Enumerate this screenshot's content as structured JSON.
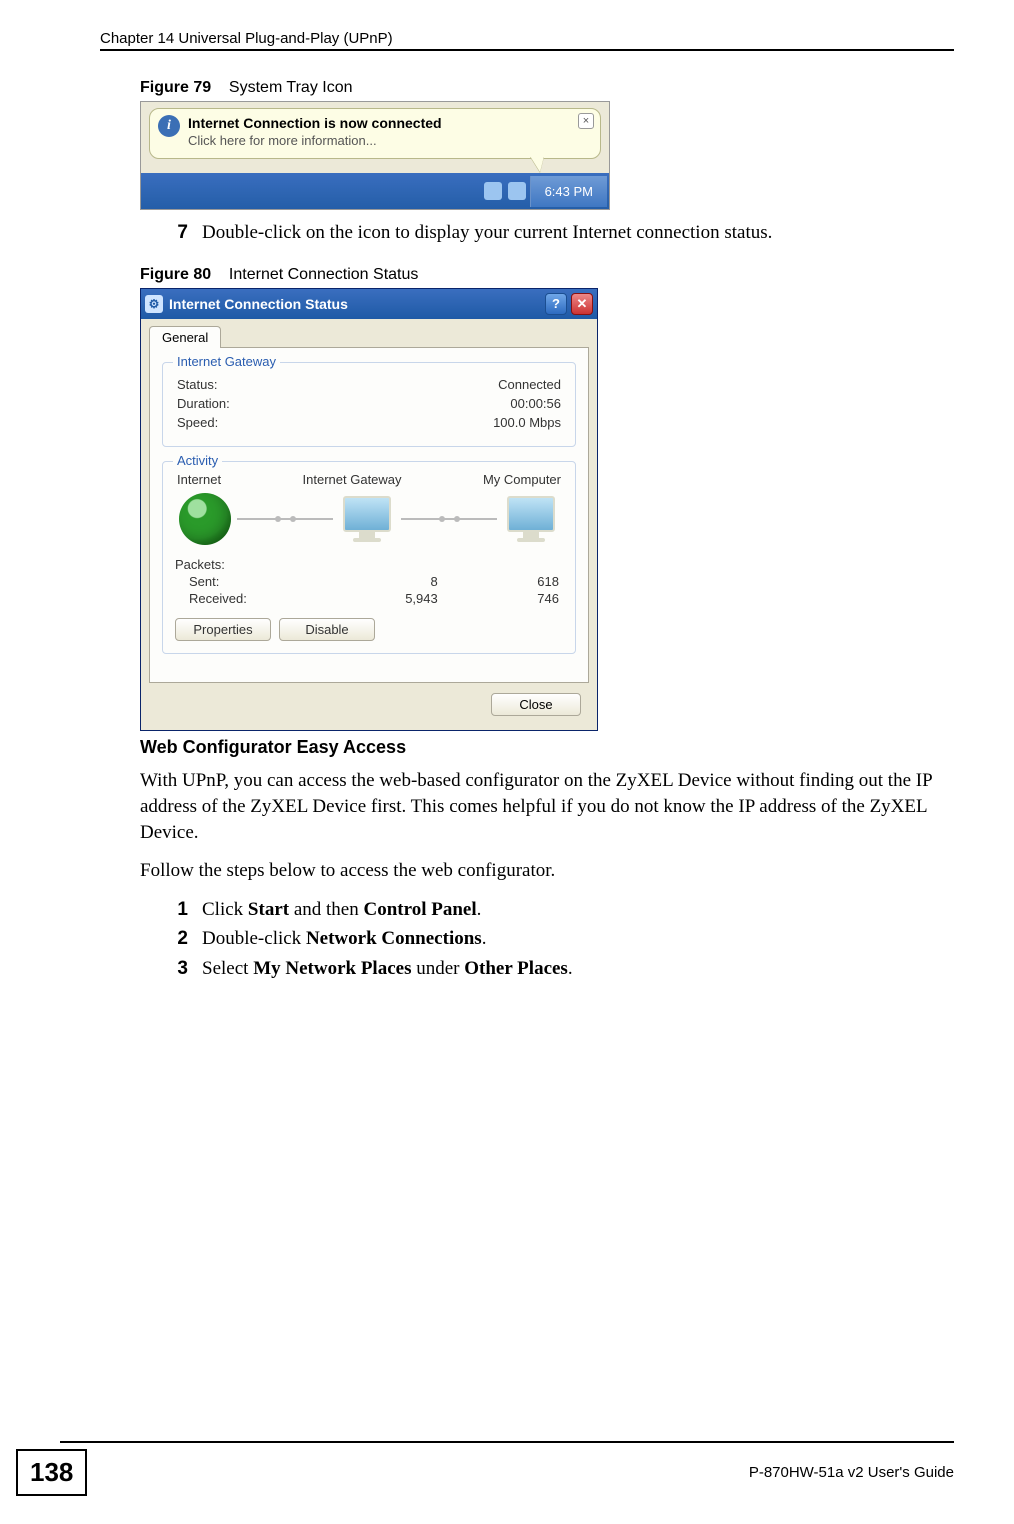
{
  "header": {
    "chapter": "Chapter 14 Universal Plug-and-Play (UPnP)"
  },
  "figure79": {
    "caption_label": "Figure 79",
    "caption_text": "System Tray Icon",
    "balloon_title": "Internet Connection is now connected",
    "balloon_sub": "Click here for more information...",
    "time": "6:43 PM"
  },
  "step7": {
    "num": "7",
    "text": "Double-click on the icon to display your current Internet connection status."
  },
  "figure80": {
    "caption_label": "Figure 80",
    "caption_text": "Internet Connection Status",
    "window_title": "Internet Connection Status",
    "tab": "General",
    "group_gateway_title": "Internet Gateway",
    "status_label": "Status:",
    "status_value": "Connected",
    "duration_label": "Duration:",
    "duration_value": "00:00:56",
    "speed_label": "Speed:",
    "speed_value": "100.0 Mbps",
    "group_activity_title": "Activity",
    "act_internet": "Internet",
    "act_gateway": "Internet Gateway",
    "act_mycomputer": "My Computer",
    "packets_label": "Packets:",
    "sent_label": "Sent:",
    "received_label": "Received:",
    "sent_gw": "8",
    "sent_pc": "618",
    "recv_gw": "5,943",
    "recv_pc": "746",
    "btn_properties": "Properties",
    "btn_disable": "Disable",
    "btn_close": "Close"
  },
  "section": {
    "heading": "Web Configurator Easy Access",
    "para1": "With UPnP, you can access the web-based configurator on the ZyXEL Device without finding out the IP address of the ZyXEL Device first. This comes helpful if you do not know the IP address of the ZyXEL Device.",
    "para2": "Follow the steps below to access the web configurator."
  },
  "steps": [
    {
      "num": "1",
      "pre": "Click ",
      "b1": "Start",
      "mid": " and then ",
      "b2": "Control Panel",
      "post": "."
    },
    {
      "num": "2",
      "pre": "Double-click ",
      "b1": "Network Connections",
      "post": "."
    },
    {
      "num": "3",
      "pre": "Select ",
      "b1": "My Network Places",
      "mid": " under ",
      "b2": "Other Places",
      "post": "."
    }
  ],
  "footer": {
    "page": "138",
    "guide": "P-870HW-51a v2 User's Guide"
  }
}
